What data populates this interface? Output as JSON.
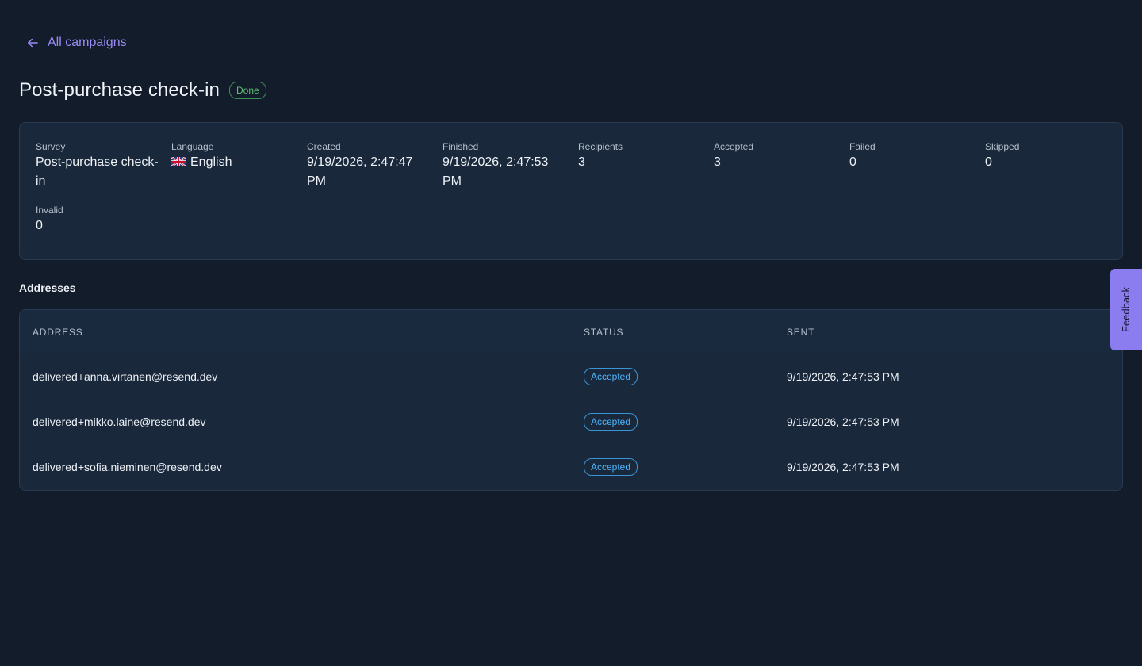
{
  "nav": {
    "back_label": "All campaigns",
    "back_icon": "arrow-left-icon"
  },
  "header": {
    "title": "Post-purchase check-in",
    "status": "Done",
    "status_color": "#5fbf74"
  },
  "summary": {
    "stats": [
      {
        "label": "Survey",
        "value": "Post-purchase check-in"
      },
      {
        "label": "Language",
        "value": "English",
        "flag": "uk-flag-icon"
      },
      {
        "label": "Created",
        "value": "9/19/2026, 2:47:47 PM"
      },
      {
        "label": "Finished",
        "value": "9/19/2026, 2:47:53 PM"
      },
      {
        "label": "Recipients",
        "value": "3"
      },
      {
        "label": "Accepted",
        "value": "3"
      },
      {
        "label": "Failed",
        "value": "0"
      },
      {
        "label": "Skipped",
        "value": "0"
      },
      {
        "label": "Invalid",
        "value": "0"
      }
    ]
  },
  "addresses": {
    "section_title": "Addresses",
    "columns": [
      "ADDRESS",
      "STATUS",
      "SENT"
    ],
    "rows": [
      {
        "address": "delivered+anna.virtanen@resend.dev",
        "status": "Accepted",
        "sent": "9/19/2026, 2:47:53 PM"
      },
      {
        "address": "delivered+mikko.laine@resend.dev",
        "status": "Accepted",
        "sent": "9/19/2026, 2:47:53 PM"
      },
      {
        "address": "delivered+sofia.nieminen@resend.dev",
        "status": "Accepted",
        "sent": "9/19/2026, 2:47:53 PM"
      }
    ],
    "accepted_color": "#4db6ff"
  },
  "feedback": {
    "label": "Feedback",
    "color": "#8b7cf0"
  }
}
